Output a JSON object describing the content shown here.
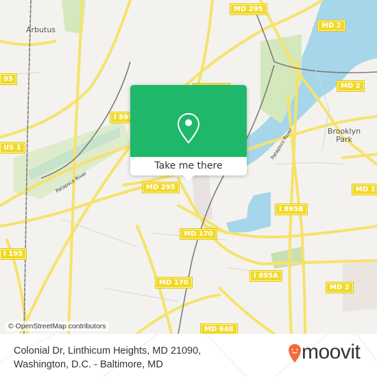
{
  "map": {
    "places": [
      {
        "name": "Arbutus"
      },
      {
        "name": "Brooklyn Park"
      }
    ],
    "water_labels": [
      {
        "name": "Patapsco River"
      },
      {
        "name": "Patapsco River"
      }
    ],
    "road_shields": [
      "MD 295",
      "MD 2",
      "MD 295",
      "MD 2",
      "95",
      "I 895",
      "US 1",
      "MD 295",
      "MD 17",
      "I 895B",
      "MD 170",
      "I 195",
      "MD 170",
      "I 895A",
      "MD 2",
      "MD 648"
    ],
    "colors": {
      "land": "#f3f2ee",
      "water": "#a6d6ea",
      "park": "#d4e8bd",
      "road": "#f6e26b",
      "rail": "#777777"
    }
  },
  "attribution": "© OpenStreetMap contributors",
  "popup": {
    "icon": "map-pin-icon",
    "cta_label": "Take me there",
    "color": "#1fb86b"
  },
  "footer": {
    "address_line1": "Colonial Dr, Linthicum Heights, MD 21090,",
    "address_line2": "Washington, D.C. - Baltimore, MD",
    "logo_text": "moovit",
    "logo_color": "#f26b3a"
  }
}
